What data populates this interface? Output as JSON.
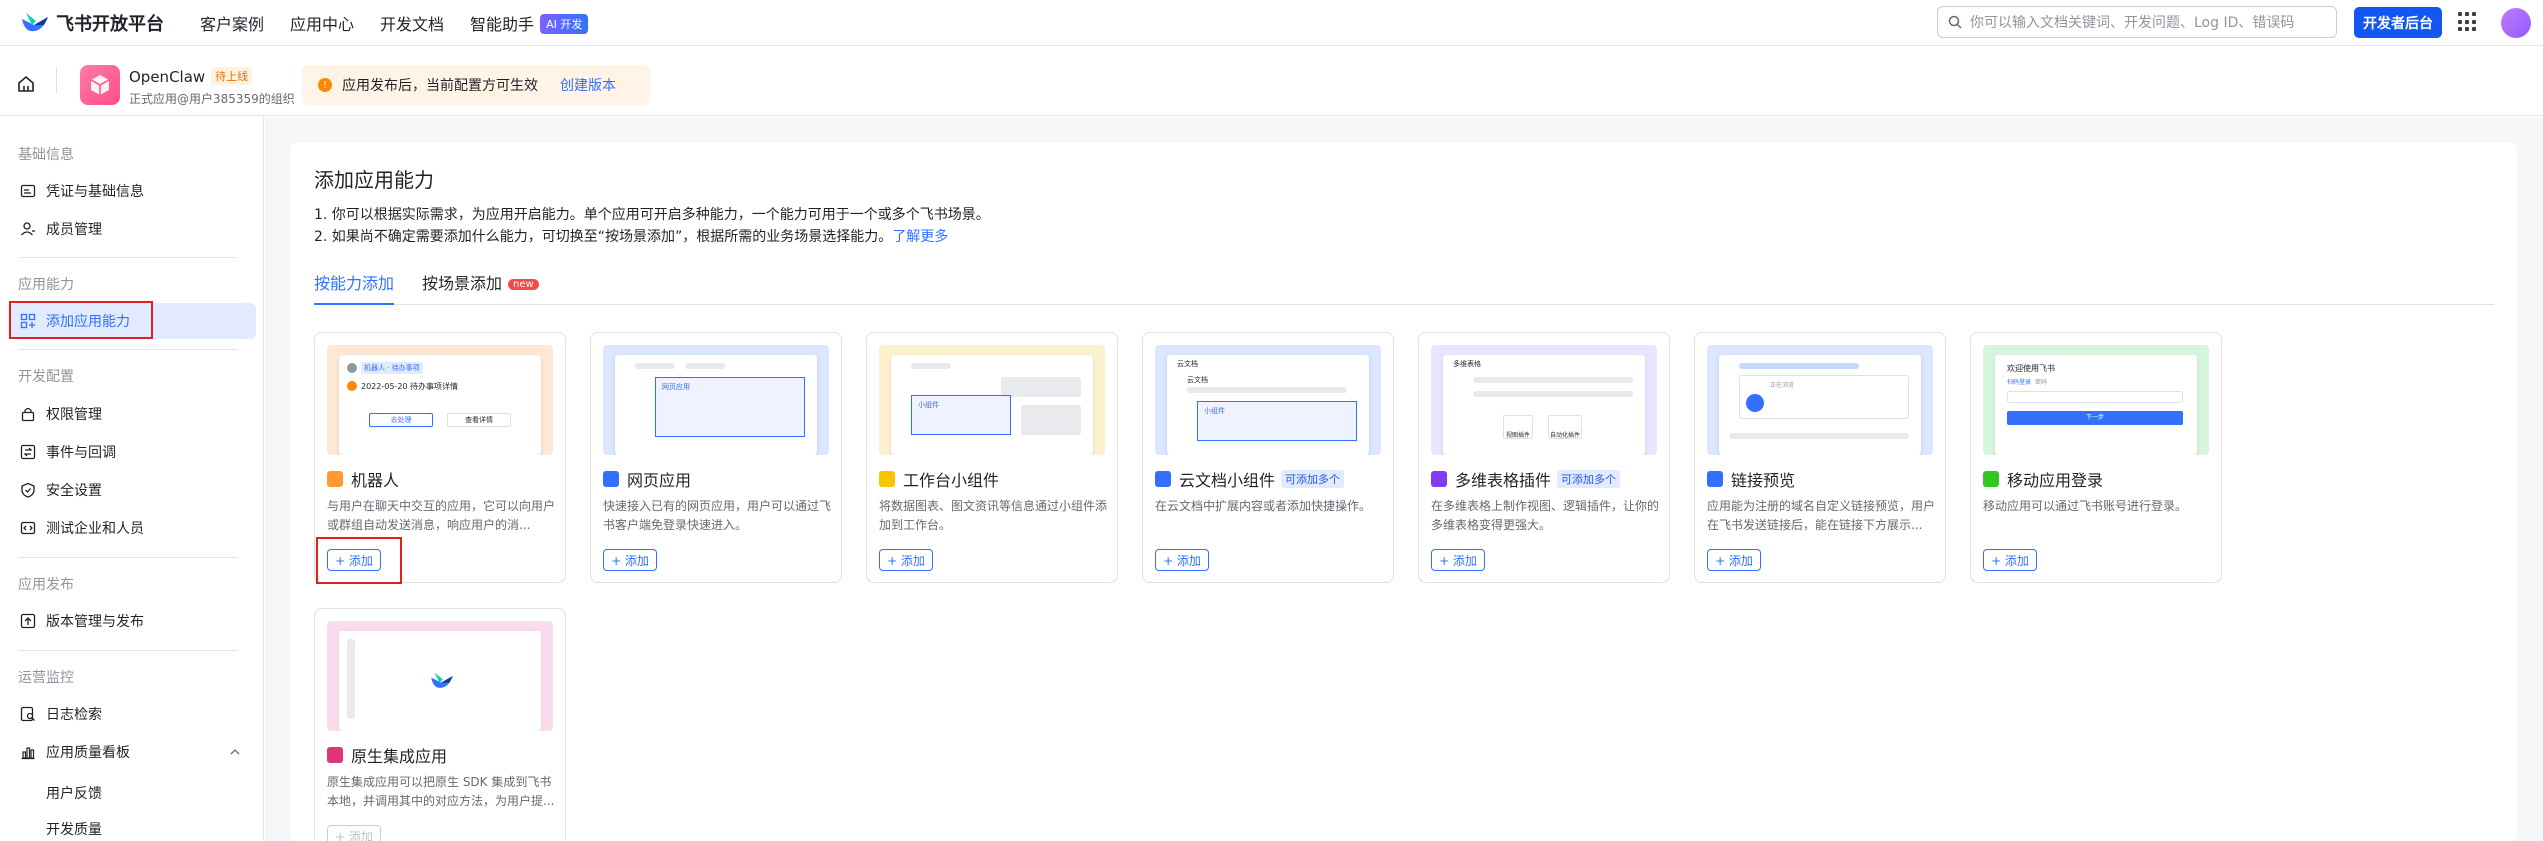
{
  "topbar": {
    "brand": "飞书开放平台",
    "nav": [
      "客户案例",
      "应用中心",
      "开发文档",
      "智能助手"
    ],
    "ai_badge": "AI 开发",
    "search_placeholder": "你可以输入文档关键词、开发问题、Log ID、错误码",
    "dev_console": "开发者后台"
  },
  "app": {
    "name": "OpenClaw",
    "status_tag": "待上线",
    "subtitle": "正式应用@用户385359的组织",
    "notice": "应用发布后，当前配置方可生效",
    "notice_link": "创建版本"
  },
  "sidebar": {
    "sec1": "基础信息",
    "item_credentials": "凭证与基础信息",
    "item_members": "成员管理",
    "sec2": "应用能力",
    "item_add_capability": "添加应用能力",
    "sec3": "开发配置",
    "item_permissions": "权限管理",
    "item_events": "事件与回调",
    "item_security": "安全设置",
    "item_test": "测试企业和人员",
    "sec4": "应用发布",
    "item_version": "版本管理与发布",
    "sec5": "运营监控",
    "item_logs": "日志检索",
    "item_quality": "应用质量看板",
    "item_feedback": "用户反馈",
    "item_devquality": "开发质量"
  },
  "main": {
    "title": "添加应用能力",
    "desc1": "1. 你可以根据实际需求，为应用开启能力。单个应用可开启多种能力，一个能力可用于一个或多个飞书场景。",
    "desc2": "2. 如果尚不确定需要添加什么能力，可切换至“按场景添加”，根据所需的业务场景选择能力。",
    "learn_more": "了解更多",
    "tab1": "按能力添加",
    "tab2": "按场景添加",
    "tab2_badge": "new",
    "add_label": "+ 添加",
    "cards": [
      {
        "title": "机器人",
        "tag": "",
        "desc": "与用户在聊天中交互的应用，它可以向用户或群组自动发送消息，响应用户的消..."
      },
      {
        "title": "网页应用",
        "tag": "",
        "desc": "快速接入已有的网页应用，用户可以通过飞书客户端免登录快速进入。"
      },
      {
        "title": "工作台小组件",
        "tag": "",
        "desc": "将数据图表、图文资讯等信息通过小组件添加到工作台。"
      },
      {
        "title": "云文档小组件",
        "tag": "可添加多个",
        "desc": "在云文档中扩展内容或者添加快捷操作。"
      },
      {
        "title": "多维表格插件",
        "tag": "可添加多个",
        "desc": "在多维表格上制作视图、逻辑插件，让你的多维表格变得更强大。"
      },
      {
        "title": "链接预览",
        "tag": "",
        "desc": "应用能为注册的域名自定义链接预览，用户在飞书发送链接后，能在链接下方展示..."
      },
      {
        "title": "移动应用登录",
        "tag": "",
        "desc": "移动应用可以通过飞书账号进行登录。"
      },
      {
        "title": "原生集成应用",
        "tag": "",
        "desc": "原生集成应用可以把原生 SDK 集成到飞书本地，并调用其中的对应方法，为用户提..."
      }
    ],
    "thumb_text": {
      "bot_chip": "机器人 · 待办事项",
      "bot_line": "2022-05-20 待办事项详情",
      "bot_btn1": "去处理",
      "bot_btn2": "查看详情",
      "web_label": "网页应用",
      "widget_label": "小组件",
      "doc_title": "云文档",
      "doc_sub": "云文档",
      "doc_label": "小组件",
      "base_title": "多维表格",
      "base_btn1": "视图插件",
      "base_btn2": "自动化插件",
      "link_sub": "正在浏览",
      "login_title": "欢迎使用飞书",
      "login_tab1": "扫码登录",
      "login_tab2": "密码",
      "login_btn": "下一步"
    }
  }
}
